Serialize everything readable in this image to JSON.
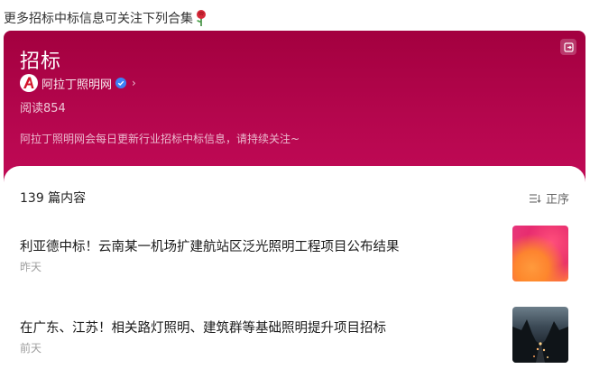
{
  "top_note": {
    "text": "更多招标中标信息可关注下列合集"
  },
  "header": {
    "title": "招标",
    "account_name": "阿拉丁照明网",
    "reads_label": "阅读",
    "reads_count": "854",
    "description": "阿拉丁照明网会每日更新行业招标中标信息，请持续关注~",
    "colors": {
      "gradient_top": "#a3003f",
      "gradient_bottom": "#c10a56",
      "verified": "#3b82f6"
    }
  },
  "list": {
    "count_text": "139 篇内容",
    "sort_label": "正序",
    "articles": [
      {
        "title": "利亚德中标！云南某一机场扩建航站区泛光照明工程项目公布结果",
        "time": "昨天",
        "thumb": "orange-pink-abstract"
      },
      {
        "title": "在广东、江苏！相关路灯照明、建筑群等基础照明提升项目招标",
        "time": "前天",
        "thumb": "street-night-scene"
      }
    ]
  }
}
